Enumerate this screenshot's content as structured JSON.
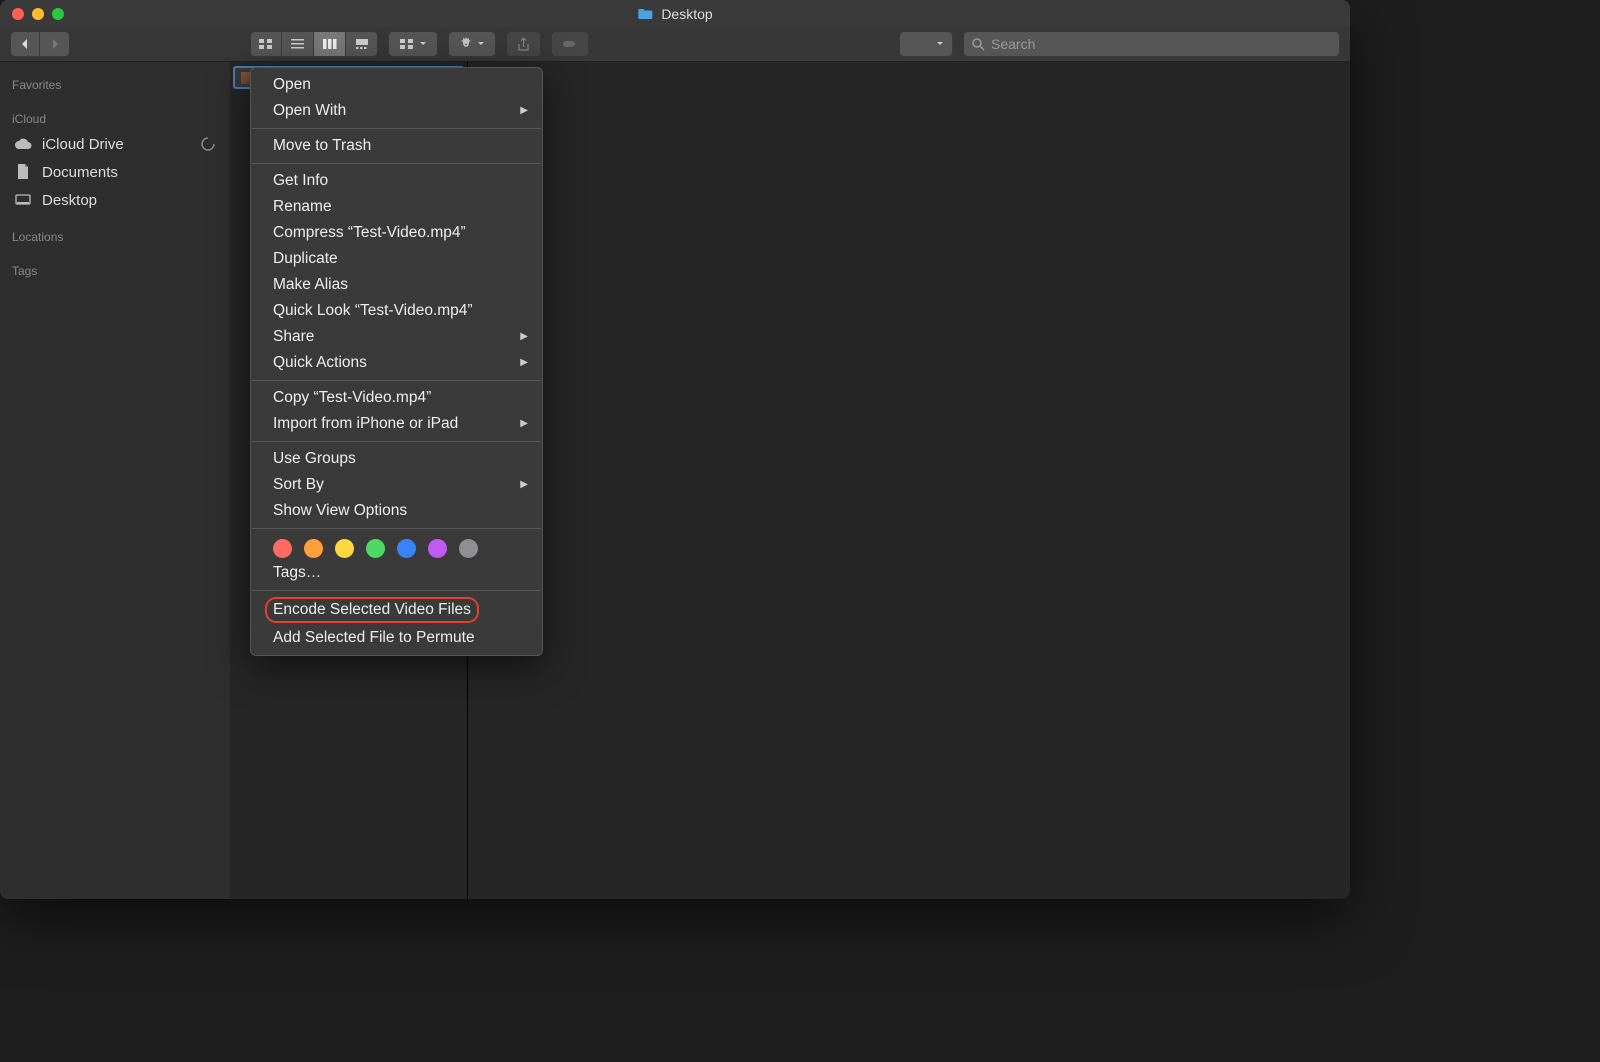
{
  "window": {
    "title": "Desktop"
  },
  "toolbar": {
    "search_placeholder": "Search"
  },
  "sidebar": {
    "favorites_heading": "Favorites",
    "icloud_heading": "iCloud",
    "locations_heading": "Locations",
    "tags_heading": "Tags",
    "items": {
      "icloud_drive": "iCloud Drive",
      "documents": "Documents",
      "desktop": "Desktop"
    }
  },
  "file": {
    "name": "Test-Video.mp4"
  },
  "context_menu": {
    "open": "Open",
    "open_with": "Open With",
    "move_to_trash": "Move to Trash",
    "get_info": "Get Info",
    "rename": "Rename",
    "compress": "Compress “Test-Video.mp4”",
    "duplicate": "Duplicate",
    "make_alias": "Make Alias",
    "quick_look": "Quick Look “Test-Video.mp4”",
    "share": "Share",
    "quick_actions": "Quick Actions",
    "copy": "Copy “Test-Video.mp4”",
    "import_ios": "Import from iPhone or iPad",
    "use_groups": "Use Groups",
    "sort_by": "Sort By",
    "show_view_options": "Show View Options",
    "tags_label": "Tags…",
    "encode_video": "Encode Selected Video Files",
    "add_permute": "Add Selected File to Permute"
  }
}
